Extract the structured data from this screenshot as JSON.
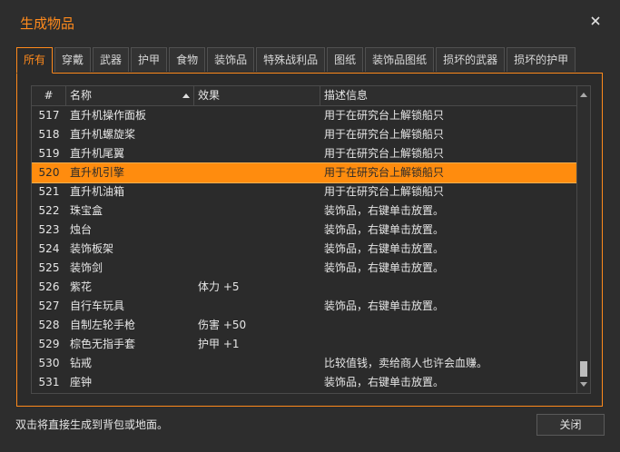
{
  "window": {
    "title": "生成物品",
    "accent_color": "#ff8a1c"
  },
  "tabs": [
    {
      "label": "所有",
      "active": true
    },
    {
      "label": "穿戴"
    },
    {
      "label": "武器"
    },
    {
      "label": "护甲"
    },
    {
      "label": "食物"
    },
    {
      "label": "装饰品"
    },
    {
      "label": "特殊战利品"
    },
    {
      "label": "图纸"
    },
    {
      "label": "装饰品图纸"
    },
    {
      "label": "损坏的武器"
    },
    {
      "label": "损坏的护甲"
    }
  ],
  "table": {
    "columns": [
      "#",
      "名称",
      "效果",
      "描述信息"
    ],
    "sort_column": "名称",
    "sort_direction": "ascending",
    "selected_row": "520",
    "rows": [
      {
        "num": "517",
        "name": "直升机操作面板",
        "effect": "",
        "desc": "用于在研究台上解锁船只"
      },
      {
        "num": "518",
        "name": "直升机螺旋桨",
        "effect": "",
        "desc": "用于在研究台上解锁船只"
      },
      {
        "num": "519",
        "name": "直升机尾翼",
        "effect": "",
        "desc": "用于在研究台上解锁船只"
      },
      {
        "num": "520",
        "name": "直升机引擎",
        "effect": "",
        "desc": "用于在研究台上解锁船只"
      },
      {
        "num": "521",
        "name": "直升机油箱",
        "effect": "",
        "desc": "用于在研究台上解锁船只"
      },
      {
        "num": "522",
        "name": "珠宝盒",
        "effect": "",
        "desc": "装饰品，右键单击放置。"
      },
      {
        "num": "523",
        "name": "烛台",
        "effect": "",
        "desc": "装饰品，右键单击放置。"
      },
      {
        "num": "524",
        "name": "装饰板架",
        "effect": "",
        "desc": "装饰品，右键单击放置。"
      },
      {
        "num": "525",
        "name": "装饰剑",
        "effect": "",
        "desc": "装饰品，右键单击放置。"
      },
      {
        "num": "526",
        "name": "紫花",
        "effect": "体力 +5",
        "desc": ""
      },
      {
        "num": "527",
        "name": "自行车玩具",
        "effect": "",
        "desc": "装饰品，右键单击放置。"
      },
      {
        "num": "528",
        "name": "自制左轮手枪",
        "effect": "伤害 +50",
        "desc": ""
      },
      {
        "num": "529",
        "name": "棕色无指手套",
        "effect": "护甲 +1",
        "desc": ""
      },
      {
        "num": "530",
        "name": "钻戒",
        "effect": "",
        "desc": "比较值钱，卖给商人也许会血赚。"
      },
      {
        "num": "531",
        "name": "座钟",
        "effect": "",
        "desc": "装饰品，右键单击放置。"
      }
    ]
  },
  "footer": {
    "hint": "双击将直接生成到背包或地面。",
    "close_label": "关闭"
  },
  "icons": {
    "close": "close-icon",
    "sort": "sort-ascending-icon",
    "scroll_up": "scroll-up-icon",
    "scroll_down": "scroll-down-icon"
  }
}
